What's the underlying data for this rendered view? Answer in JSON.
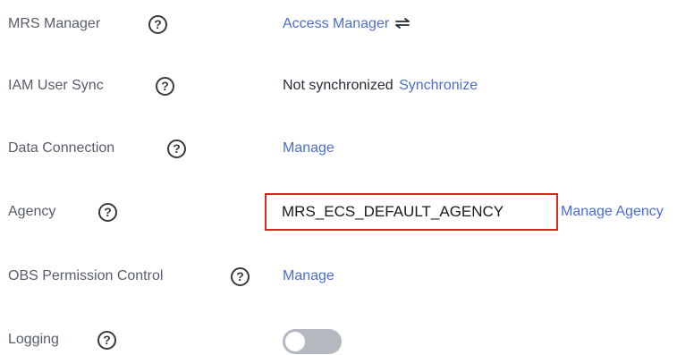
{
  "settings": {
    "mrs_manager": {
      "label": "MRS Manager",
      "help": "?",
      "link": "Access Manager",
      "link_icon": "swap-arrows-icon"
    },
    "iam_user_sync": {
      "label": "IAM User Sync",
      "help": "?",
      "status": "Not synchronized",
      "action": "Synchronize"
    },
    "data_connection": {
      "label": "Data Connection",
      "help": "?",
      "action": "Manage"
    },
    "agency": {
      "label": "Agency",
      "help": "?",
      "value": "MRS_ECS_DEFAULT_AGENCY",
      "action": "Manage Agency",
      "highlight_color": "#d9281e"
    },
    "obs_permission_control": {
      "label": "OBS Permission Control",
      "help": "?",
      "action": "Manage"
    },
    "logging": {
      "label": "Logging",
      "help": "?",
      "enabled": false
    }
  },
  "colors": {
    "link": "#4a6cd8",
    "label": "#575d6c",
    "toggle_off": "#b4b8bf"
  }
}
